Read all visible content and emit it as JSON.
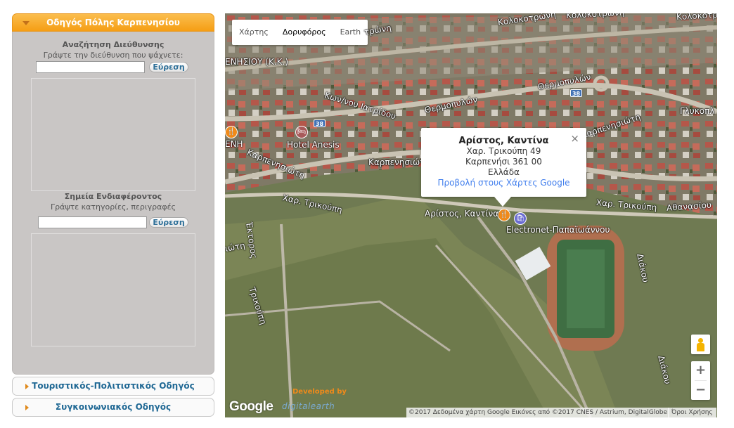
{
  "sidebar": {
    "city_guide_title": "Οδηγός Πόλης Καρπενησίου",
    "address_search": {
      "title": "Αναζήτηση Διεύθυνσης",
      "hint": "Γράψτε την διεύθυνση που ψάχνετε:",
      "input_value": "",
      "button_label": "Εύρεση"
    },
    "poi_search": {
      "title": "Σημεία Ενδιαφέροντος",
      "hint": "Γράψτε κατηγορίες, περιγραφές",
      "input_value": "",
      "button_label": "Εύρεση"
    },
    "tourist_guide_title": "Τουριστικός-Πολιτιστικός Οδηγός",
    "transport_guide_title": "Συγκοινωνιακός Οδηγός"
  },
  "map": {
    "type_buttons": [
      "Χάρτης",
      "Δορυφόρος",
      "Earth"
    ],
    "active_type": "Δορυφόρος",
    "streets": {
      "kolokotroni_1": "Κολοκοτρώνη",
      "kolokotroni_2": "Κολοκοτρώνη",
      "kolokotroni_3": "Κολοκοτρ",
      "ntrwn": "τρώνη",
      "enisiou": "ΕΝΗΣΙΟΥ (Κ.Κ.)",
      "kwn_iatridou": "Κων/νου Ιατρίδου",
      "thermopylwn_1": "Θερμοπυλών",
      "thermopylwn_2": "Θερμοπυλών",
      "glykopl": "Γλυκοπλ",
      "karpenisiwtis_1": "Καρπενησιώτη",
      "karpenisiwtis_2": "Καρπενησιώτη",
      "karpenisiwtis_3": "Καρπενησιώτη",
      "karpenisiwtis_4": "ιώτη",
      "char_trikoupi_1": "Χαρ. Τρικούπη",
      "char_trikoupi_2": "Χαρ. Τρικούπη",
      "trikoupi_v": "Τρικούπη",
      "ektoros": "Έκτορος",
      "athanasiou": "Αθανασίου",
      "diakou_1": "Διάκου",
      "diakou_2": "Διάκου",
      "enh": "ΕΝΗ"
    },
    "route_shields": [
      "38",
      "38"
    ],
    "pois": {
      "hotel": "Hotel Anesis",
      "kantina": "Αρίστος, Καντίνα",
      "electronet": "Electronet-Παπαϊωάννου"
    },
    "info_window": {
      "title": "Αρίστος, Καντίνα",
      "street": "Χαρ. Τρικούπη 49",
      "city_zip": "Καρπενήσι 361 00",
      "country": "Ελλάδα",
      "link": "Προβολή στους Χάρτες Google",
      "close_glyph": "×"
    },
    "zoom_in": "+",
    "zoom_out": "−",
    "google_logo": "Google",
    "developed_by": "Developed by",
    "developer_logo": "digitalearth",
    "attribution": "©2017 Δεδομένα χάρτη Google Εικόνες από ©2017 CNES / Astrium, DigitalGlobe",
    "terms": "Όροι Χρήσης"
  },
  "colors": {
    "accent_orange": "#f59e14",
    "link_blue": "#1f6894",
    "panel_grey": "#c9c6c5"
  }
}
